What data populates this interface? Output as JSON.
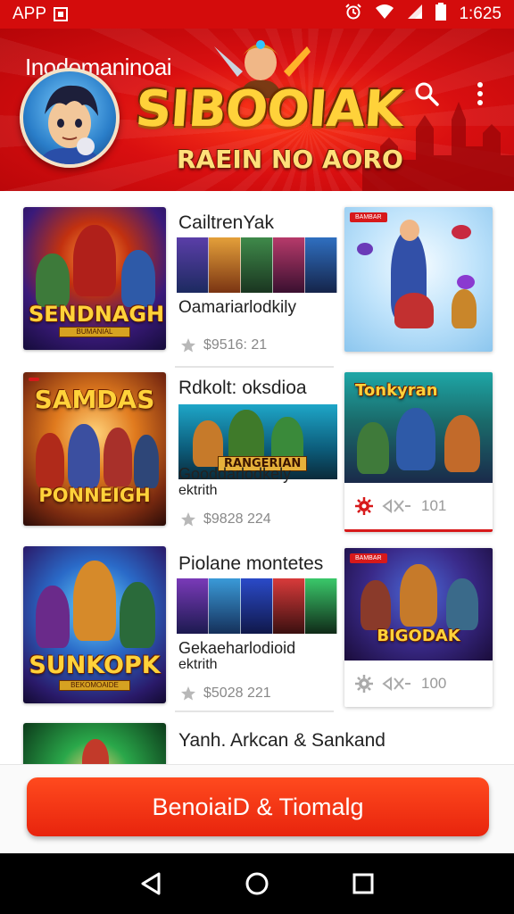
{
  "status_bar": {
    "left_label": "APP",
    "time": "1:625"
  },
  "header": {
    "title": "Inodomaninoai",
    "logo_text": "SIBOOIAK",
    "logo_subtitle": "RAEIN NO AORO"
  },
  "icons": {
    "app": "app-icon",
    "alarm": "alarm-icon",
    "wifi": "wifi-icon",
    "signal": "signal-icon",
    "battery": "battery-icon",
    "search": "search-icon",
    "more": "more-vert-icon",
    "star": "star-icon",
    "share": "share-icon",
    "back": "back-icon",
    "home": "home-icon",
    "recents": "recents-icon"
  },
  "rows": [
    {
      "thumb_title": "SENDNAGH",
      "thumb_sub": "BUMANIAL",
      "mid_title": "CailtrenYak",
      "mid_sub_line1": "Oamariarlodkily",
      "mid_sub_line2": "",
      "meta": "$9516: 21",
      "card_tag": "BAMBAR",
      "card_thumb_title": "",
      "card_thumb_sub": "",
      "card_footer": ""
    },
    {
      "thumb_title": "SAMDAS",
      "thumb_sub": "PONNEIGH",
      "mid_title": "Rdkolt: oksdioa",
      "mid_banner_text": "RANGERIAN",
      "mid_sub_line1": "Gooddarlodkely",
      "mid_sub_line2": "ektrith",
      "meta": "$9828 224",
      "card_tag": "",
      "card_thumb_title": "Tonkyran",
      "card_thumb_sub": "",
      "card_footer": "101"
    },
    {
      "thumb_title": "SUNKOPK",
      "thumb_sub": "BEKOMOAIDE",
      "mid_title": "Piolane montetes",
      "mid_sub_line1": "Gekaeharlodioid",
      "mid_sub_line2": "ektrith",
      "meta": "$5028 221",
      "card_tag": "BAMBAR",
      "card_thumb_title": "BIGODAK",
      "card_thumb_sub": "",
      "card_footer": "100"
    },
    {
      "thumb_title": "",
      "thumb_sub": "",
      "mid_title": "Yanh. Arkcan & Sankand"
    }
  ],
  "bottom_button": {
    "label": "BenoiaiD & Tiomalg"
  },
  "colors": {
    "brand_red": "#d40c0c",
    "button_red": "#f03a16",
    "logo_gold": "#ffd23a"
  }
}
